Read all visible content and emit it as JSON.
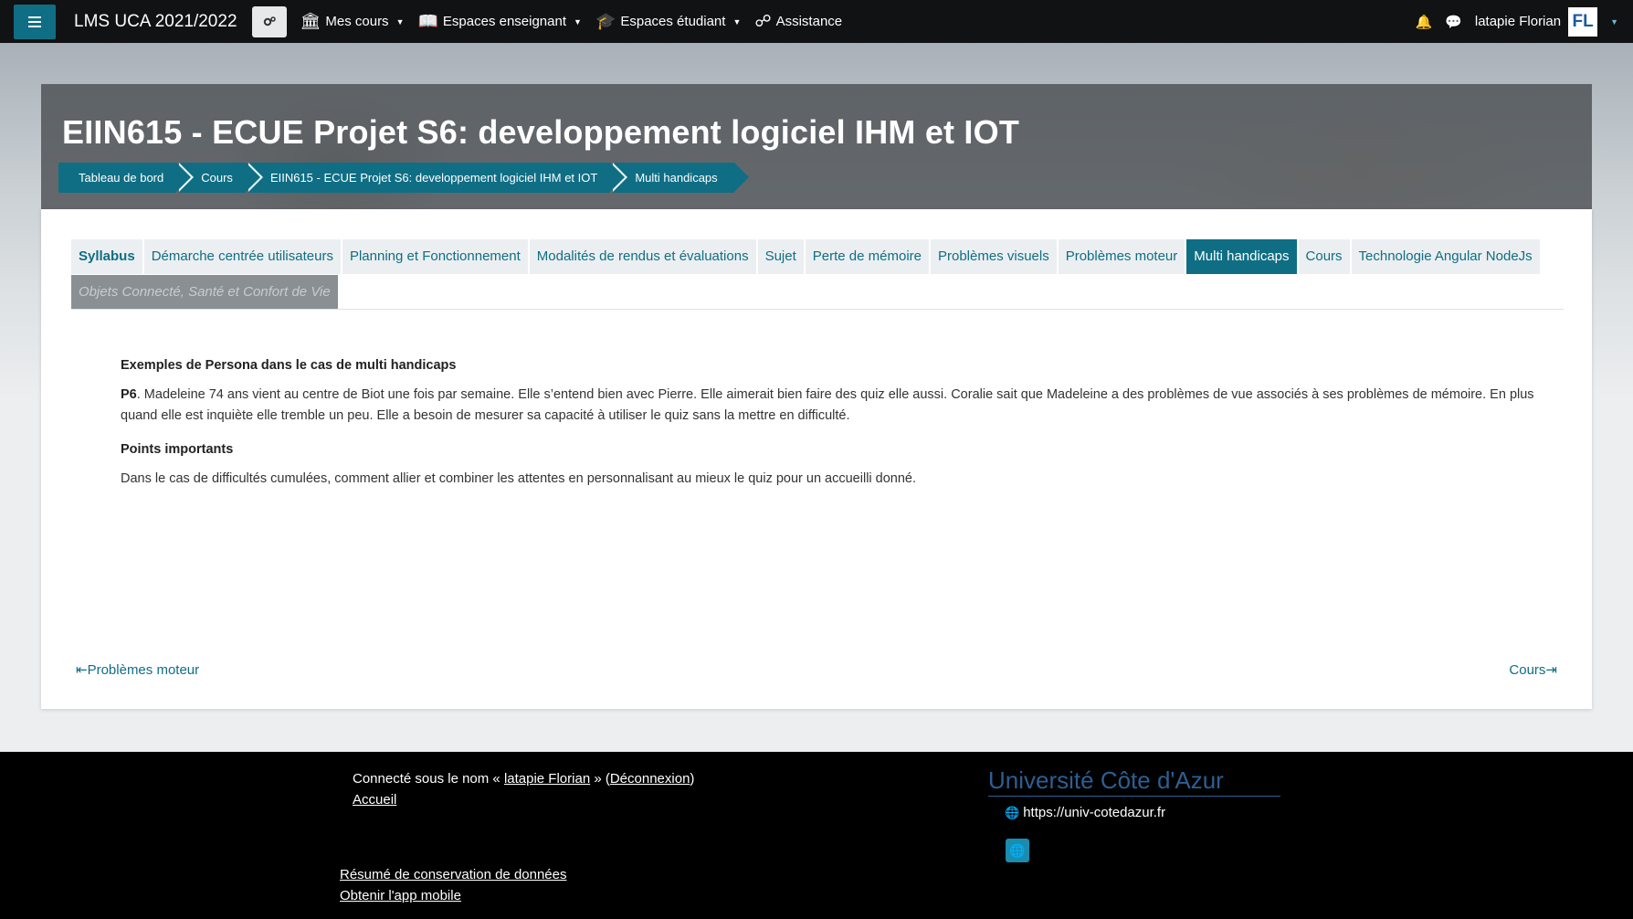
{
  "navbar": {
    "brand": "LMS UCA 2021/2022",
    "items": [
      {
        "label": "Mes cours",
        "icon": "bank-icon"
      },
      {
        "label": "Espaces enseignant",
        "icon": "book-icon"
      },
      {
        "label": "Espaces étudiant",
        "icon": "graduation-cap-icon"
      },
      {
        "label": "Assistance",
        "icon": "lifebuoy-icon"
      }
    ],
    "user_name": "latapie Florian",
    "avatar_initials": "FL"
  },
  "header": {
    "title": "EIIN615 - ECUE Projet S6: developpement logiciel IHM et IOT",
    "breadcrumb": [
      "Tableau de bord",
      "Cours",
      "EIIN615 - ECUE Projet S6: developpement logiciel IHM et IOT",
      "Multi handicaps"
    ]
  },
  "tabs": {
    "items": [
      "Syllabus",
      "Démarche centrée utilisateurs",
      "Planning et Fonctionnement",
      "Modalités de rendus et évaluations",
      "Sujet",
      "Perte de mémoire",
      "Problèmes visuels",
      "Problèmes moteur",
      "Multi handicaps",
      "Cours",
      "Technologie Angular NodeJs",
      "Objets Connecté, Santé et Confort de Vie"
    ],
    "active": "Multi handicaps"
  },
  "content": {
    "heading": "Exemples de Persona dans le cas de multi handicaps",
    "persona_label": "P6",
    "persona_text": ". Madeleine 74 ans vient au centre de Biot une fois par semaine. Elle s’entend bien avec Pierre. Elle aimerait bien faire des quiz elle aussi. Coralie sait que Madeleine a des problèmes de vue associés à ses problèmes de mémoire. En plus quand elle est inquiète elle tremble un peu. Elle a besoin de mesurer sa capacité à utiliser le quiz sans la mettre en difficulté.",
    "points_heading": "Points importants",
    "points_text": "Dans le cas de difficultés cumulées, comment allier et combiner les attentes en personnalisant au mieux le quiz pour un accueilli donné."
  },
  "pager": {
    "prev": "Problèmes moteur",
    "next": "Cours"
  },
  "footer": {
    "login_prefix": "Connecté sous le nom «",
    "login_user": "latapie Florian",
    "login_mid": "» (",
    "logout": "Déconnexion",
    "login_suffix": ")",
    "home": "Accueil",
    "data_retention": "Résumé de conservation de données",
    "mobile_app": "Obtenir l'app mobile",
    "university": "Université Côte d'Azur",
    "university_url": "https://univ-cotedazur.fr"
  }
}
